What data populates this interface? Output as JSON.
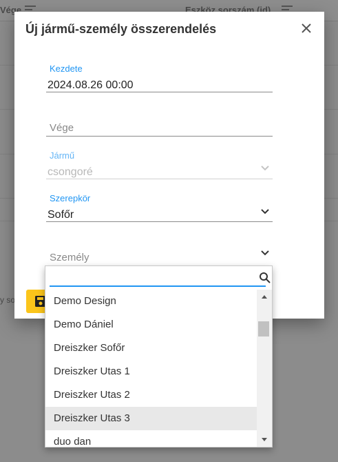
{
  "background": {
    "col_end": "Vége",
    "col_device_serial": "Eszköz sorszám (id)",
    "cut_text": "y so"
  },
  "dialog": {
    "title": "Új jármű-személy összerendelés",
    "fields": {
      "start": {
        "label": "Kezdete",
        "value": "2024.08.26 00:00"
      },
      "end": {
        "placeholder": "Vége"
      },
      "vehicle": {
        "label": "Jármű",
        "value": "csongoré"
      },
      "role": {
        "label": "Szerepkör",
        "value": "Sofőr"
      },
      "person": {
        "placeholder": "Személy"
      }
    }
  },
  "dropdown": {
    "search_value": "",
    "options": [
      "Demo Design",
      "Demo Dániel",
      "Dreiszker Sofőr",
      "Dreiszker Utas 1",
      "Dreiszker Utas 2",
      "Dreiszker Utas 3",
      "duo dan"
    ],
    "highlighted": "Dreiszker Utas 3"
  },
  "colors": {
    "accent": "#2196f3",
    "save_button": "#fbc51b",
    "highlight": "#e8e8e8"
  }
}
